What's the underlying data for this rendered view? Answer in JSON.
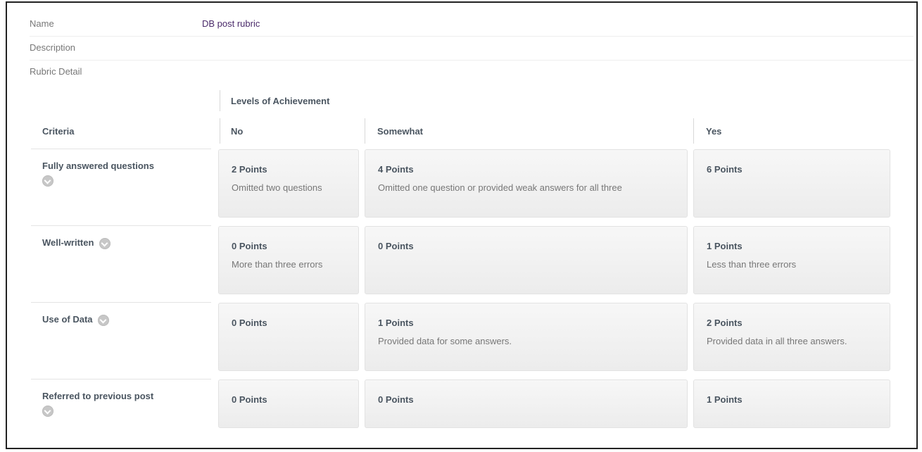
{
  "name_label": "Name",
  "name_value": "DB post rubric",
  "description_label": "Description",
  "rubric_detail_label": "Rubric Detail",
  "levels_label": "Levels of Achievement",
  "criteria_header": "Criteria",
  "levels": [
    "No",
    "Somewhat",
    "Yes"
  ],
  "criteria": [
    {
      "name": "Fully answered questions",
      "cells": [
        {
          "points": "2 Points",
          "desc": "Omitted two questions"
        },
        {
          "points": "4 Points",
          "desc": "Omitted one question or provided weak answers for all three"
        },
        {
          "points": "6 Points",
          "desc": ""
        }
      ]
    },
    {
      "name": "Well-written",
      "cells": [
        {
          "points": "0 Points",
          "desc": "More than three errors"
        },
        {
          "points": "0 Points",
          "desc": ""
        },
        {
          "points": "1 Points",
          "desc": "Less than three errors"
        }
      ]
    },
    {
      "name": "Use of Data",
      "cells": [
        {
          "points": "0 Points",
          "desc": ""
        },
        {
          "points": "1 Points",
          "desc": "Provided data for some answers."
        },
        {
          "points": "2 Points",
          "desc": "Provided data in all three answers."
        }
      ]
    },
    {
      "name": "Referred to previous post",
      "cells": [
        {
          "points": "0 Points",
          "desc": ""
        },
        {
          "points": "0 Points",
          "desc": ""
        },
        {
          "points": "1 Points",
          "desc": ""
        }
      ]
    }
  ]
}
